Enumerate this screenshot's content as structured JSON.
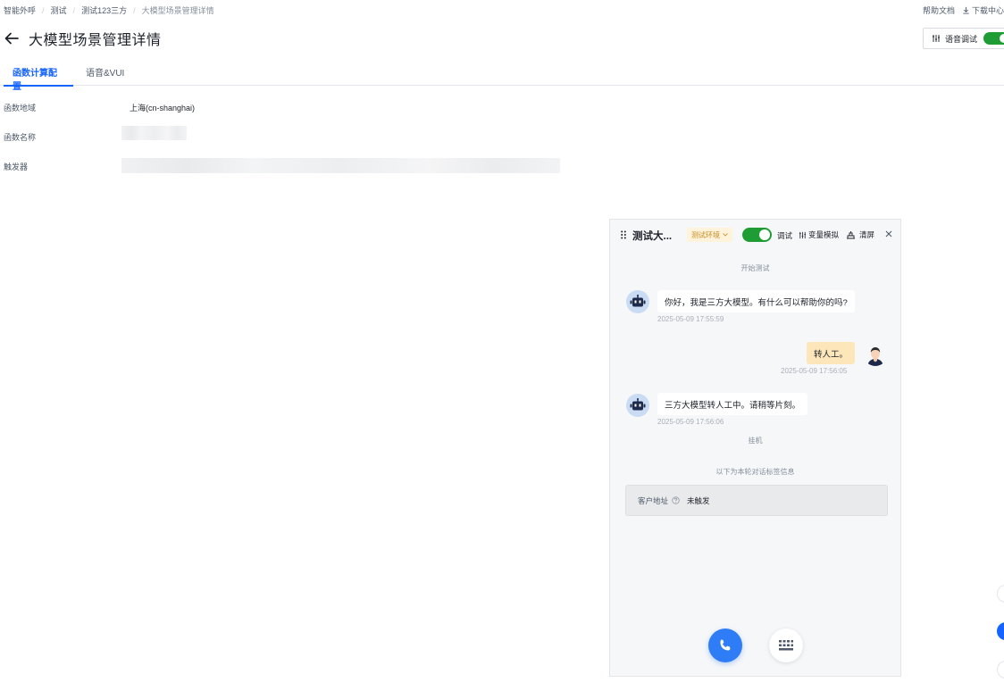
{
  "breadcrumb": {
    "items": [
      "智能外呼",
      "测试",
      "测试123三方"
    ],
    "current": "大模型场景管理详情"
  },
  "top_links": {
    "help": "帮助文档",
    "download": "下载中心"
  },
  "header": {
    "title": "大模型场景管理详情",
    "voice_debug_label": "语音调试"
  },
  "tabs": [
    {
      "label": "函数计算配置",
      "active": true
    },
    {
      "label": "语音&VUI",
      "active": false
    }
  ],
  "form": {
    "region_label": "函数地域",
    "region_value": "上海(cn-shanghai)",
    "name_label": "函数名称",
    "trigger_label": "触发器"
  },
  "panel": {
    "title": "测试大...",
    "env_tag": "测试环境",
    "debug_label": "调试",
    "var_sim_label": "变量模拟",
    "clear_label": "清屏",
    "start_msg": "开始测试",
    "messages": [
      {
        "role": "bot",
        "text": "你好，我是三方大模型。有什么可以帮助你的吗?",
        "time": "2025-05-09 17:55:59"
      },
      {
        "role": "user",
        "text": "转人工。",
        "time": "2025-05-09 17:56:05"
      },
      {
        "role": "bot",
        "text": "三方大模型转人工中。请稍等片刻。",
        "time": "2025-05-09 17:56:06"
      }
    ],
    "hangup_msg": "挂机",
    "tag_info_msg": "以下为本轮对话标签信息",
    "tag_label": "客户地址",
    "tag_value": "未触发"
  },
  "colors": {
    "accent": "#1664ff",
    "toggle_on": "#1f9d35",
    "user_bubble": "#fde6b9",
    "env_tag_bg": "#fff3dc",
    "call_button": "#2f7df6"
  }
}
